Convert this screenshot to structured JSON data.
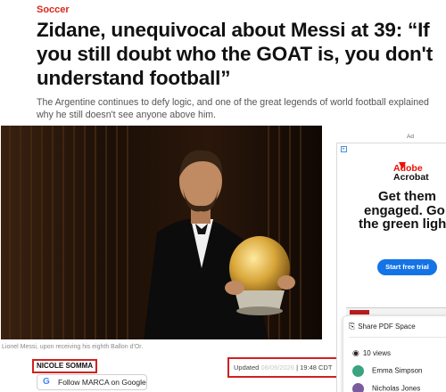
{
  "article": {
    "section": "Soccer",
    "headline": "Zidane, unequivocal about Messi at 39: “If you still doubt who the GOAT is, you don't understand football”",
    "subheadline": "The Argentine continues to defy logic, and one of the great legends of world football explained why he still doesn't see anyone above him.",
    "caption": "Lionel Messi, upon receiving his eighth Ballon d'Or.",
    "author": "NICOLE SOMMA",
    "follow_button": "Follow MARCA on Google",
    "updated_label": "Updated",
    "updated_date": "08/09/2026",
    "updated_time": "19:48 CDT"
  },
  "ad": {
    "label": "Ad",
    "close_icon": "adchoices-icon",
    "brand_line1": "Adobe",
    "brand_line2": "Acrobat",
    "headline_line1": "Get them",
    "headline_line2": "engaged. Go",
    "headline_line3": "the green light",
    "cta": "Start free trial",
    "share_label": "Share PDF Space",
    "views": "10 views",
    "people": [
      "Emma Simpson",
      "Nicholas Jones"
    ],
    "colors": {
      "brand": "#eb1000",
      "cta": "#1473e6"
    }
  },
  "colors": {
    "section": "#d6291d",
    "highlight_border": "#d32020"
  }
}
